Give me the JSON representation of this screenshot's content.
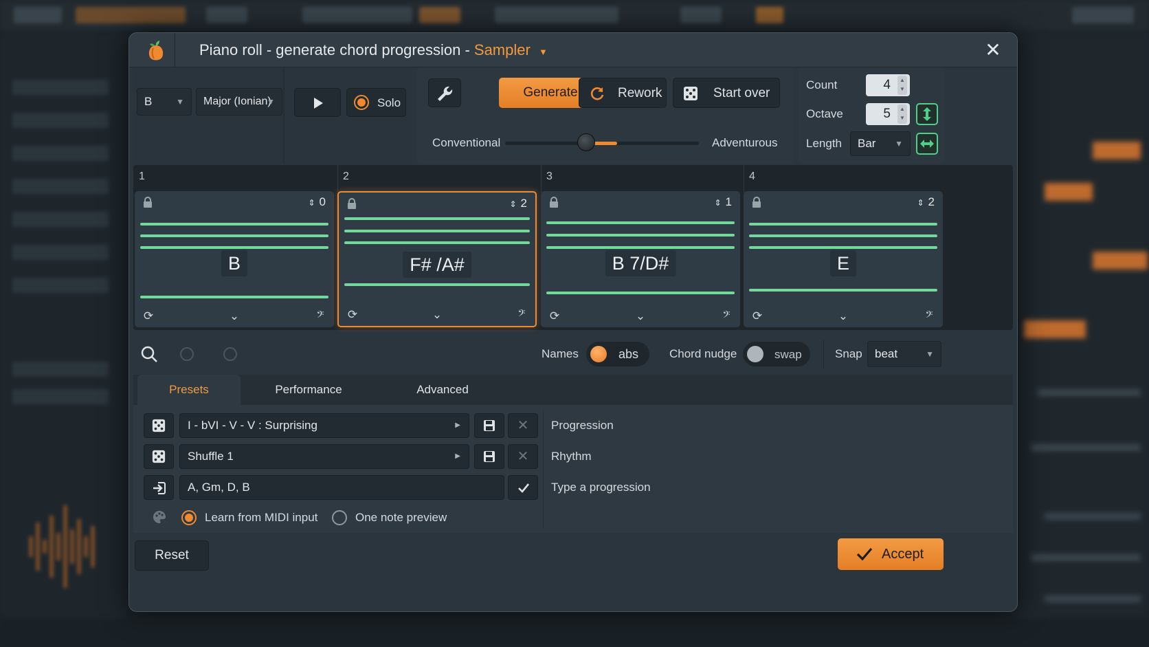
{
  "dialog": {
    "title": "Piano roll - generate chord progression - ",
    "plugin": "Sampler",
    "close_icon": "close-icon"
  },
  "key": {
    "root": "B",
    "scale": "Major (Ionian)"
  },
  "transport": {
    "solo_label": "Solo"
  },
  "actions": {
    "generate": "Generate",
    "rework": "Rework",
    "start_over": "Start over"
  },
  "style_slider": {
    "left_label": "Conventional",
    "right_label": "Adventurous",
    "value": 0.42
  },
  "settings": {
    "count_label": "Count",
    "count": "4",
    "octave_label": "Octave",
    "octave": "5",
    "length_label": "Length",
    "length": "Bar"
  },
  "bars": [
    {
      "number": "1",
      "inversion": "0",
      "chord": "B",
      "selected": false
    },
    {
      "number": "2",
      "inversion": "2",
      "chord": "F# /A#",
      "selected": true
    },
    {
      "number": "3",
      "inversion": "1",
      "chord": "B 7/D#",
      "selected": false
    },
    {
      "number": "4",
      "inversion": "2",
      "chord": "E",
      "selected": false
    }
  ],
  "options": {
    "names_label": "Names",
    "names_value": "abs",
    "nudge_label": "Chord nudge",
    "nudge_value": "swap",
    "snap_label": "Snap",
    "snap_value": "beat"
  },
  "tabs": [
    "Presets",
    "Performance",
    "Advanced"
  ],
  "presets": {
    "progression": "I - bVI - V - V : Surprising",
    "progression_label": "Progression",
    "rhythm": "Shuffle 1",
    "rhythm_label": "Rhythm",
    "typed": "A, Gm, D, B",
    "typed_label": "Type a progression",
    "learn_midi": "Learn from MIDI input",
    "one_note": "One note preview"
  },
  "footer": {
    "reset": "Reset",
    "accept": "Accept"
  },
  "colors": {
    "accent": "#f08a31",
    "green": "#73d99a",
    "panel": "#2e3942"
  }
}
